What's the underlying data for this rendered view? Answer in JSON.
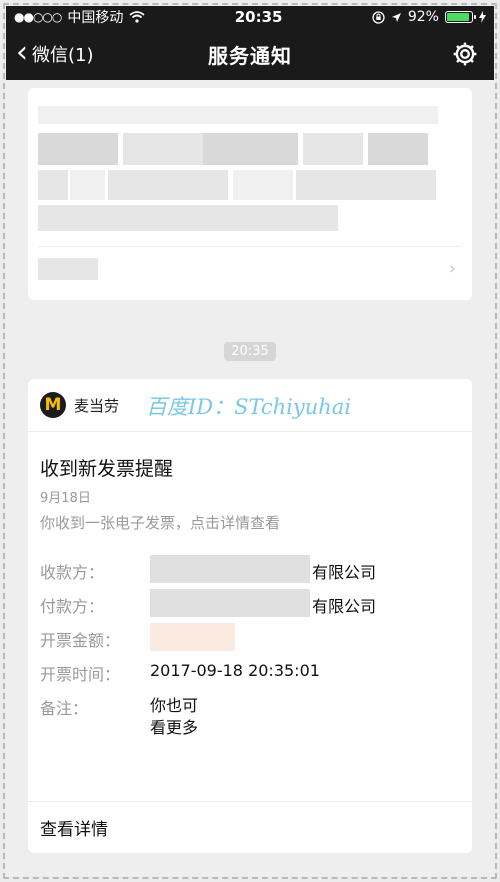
{
  "status_bar": {
    "signal": "●●○○○",
    "carrier": "中国移动",
    "time": "20:35",
    "battery_percent": "92%",
    "battery_level": 0.92
  },
  "nav": {
    "back_label": "微信(1)",
    "title": "服务通知"
  },
  "message_time": "20:35",
  "notice": {
    "brand": "麦当劳",
    "logo_glyph": "M",
    "watermark": "百度ID：STchiyuhai",
    "title": "收到新发票提醒",
    "date": "9月18日",
    "description": "你收到一张电子发票，点击详情查看",
    "fields": [
      {
        "label": "收款方：",
        "value": "有限公司"
      },
      {
        "label": "付款方：",
        "value": "有限公司"
      },
      {
        "label": "开票金额：",
        "value": ""
      },
      {
        "label": "开票时间：",
        "value": "2017-09-18 20:35:01"
      }
    ],
    "remark_label": "备注：",
    "remark_line1": "你也可",
    "remark_line2": "看更多",
    "details_label": "查看详情"
  },
  "colors": {
    "nav_background": "#1a1a1a",
    "battery": "#4cd964",
    "logo_yellow": "#f6c000",
    "watermark": "#7ac7e6"
  },
  "icons": [
    "wifi-icon",
    "lock-rotation-icon",
    "location-arrow-icon",
    "battery-icon",
    "charging-icon",
    "chevron-left-icon",
    "gear-icon",
    "chevron-right-icon",
    "mcdonalds-logo"
  ]
}
